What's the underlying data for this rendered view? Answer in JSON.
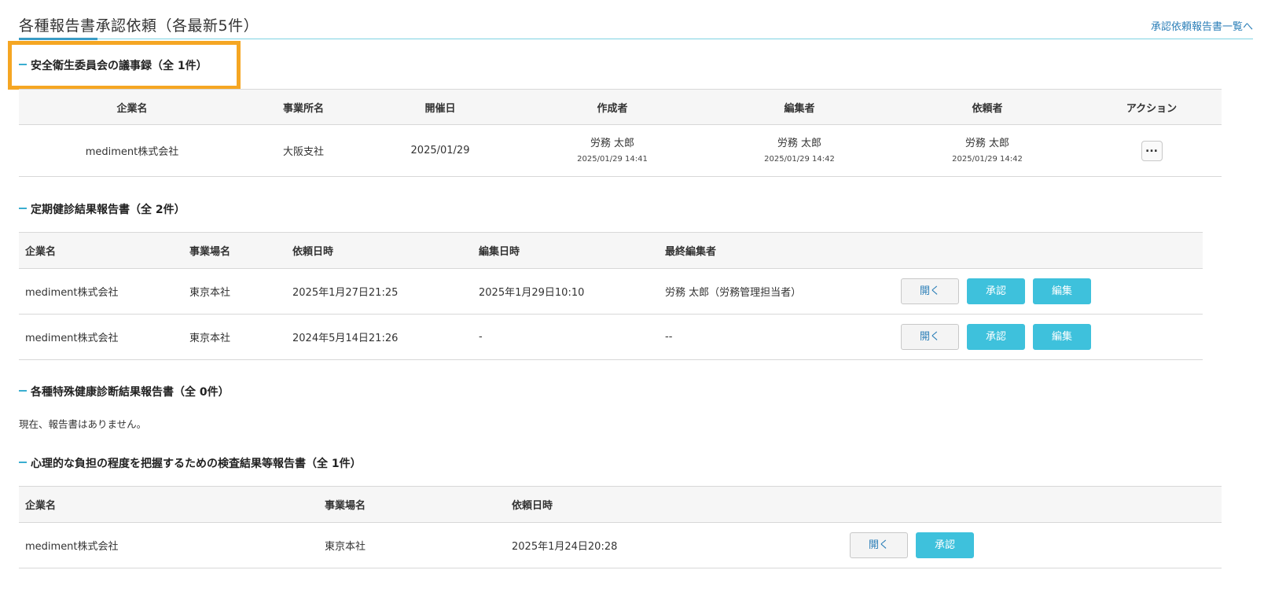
{
  "header": {
    "title": "各種報告書承認依頼（各最新5件）",
    "link": "承認依頼報告書一覧へ"
  },
  "sections": [
    {
      "title": "安全衛生委員会の議事録（全 1件）",
      "columns": [
        "企業名",
        "事業所名",
        "開催日",
        "作成者",
        "編集者",
        "依頼者",
        "アクション"
      ],
      "rows": [
        {
          "company": "mediment株式会社",
          "office": "大阪支社",
          "date": "2025/01/29",
          "creator": {
            "name": "労務 太郎",
            "time": "2025/01/29 14:41"
          },
          "editor": {
            "name": "労務 太郎",
            "time": "2025/01/29 14:42"
          },
          "requester": {
            "name": "労務 太郎",
            "time": "2025/01/29 14:42"
          },
          "action": "..."
        }
      ]
    },
    {
      "title": "定期健診結果報告書（全 2件）",
      "columns": [
        "企業名",
        "事業場名",
        "依頼日時",
        "編集日時",
        "最終編集者"
      ],
      "rows": [
        {
          "company": "mediment株式会社",
          "site": "東京本社",
          "requested": "2025年1月27日21:25",
          "edited": "2025年1月29日10:10",
          "editor": "労務 太郎（労務管理担当者）"
        },
        {
          "company": "mediment株式会社",
          "site": "東京本社",
          "requested": "2024年5月14日21:26",
          "edited": "-",
          "editor": "--"
        }
      ]
    },
    {
      "title": "各種特殊健康診断結果報告書（全 0件）",
      "empty_message": "現在、報告書はありません。"
    },
    {
      "title": "心理的な負担の程度を把握するための検査結果等報告書（全 1件）",
      "columns": [
        "企業名",
        "事業場名",
        "依頼日時"
      ],
      "rows": [
        {
          "company": "mediment株式会社",
          "site": "東京本社",
          "requested": "2025年1月24日20:28"
        }
      ]
    }
  ],
  "buttons": {
    "open": "開く",
    "approve": "承認",
    "edit": "編集"
  },
  "colors": {
    "accent": "#3ec1dc",
    "link": "#2c7fb8",
    "highlight": "#f5a623",
    "header_border": "#7fd3e3"
  }
}
